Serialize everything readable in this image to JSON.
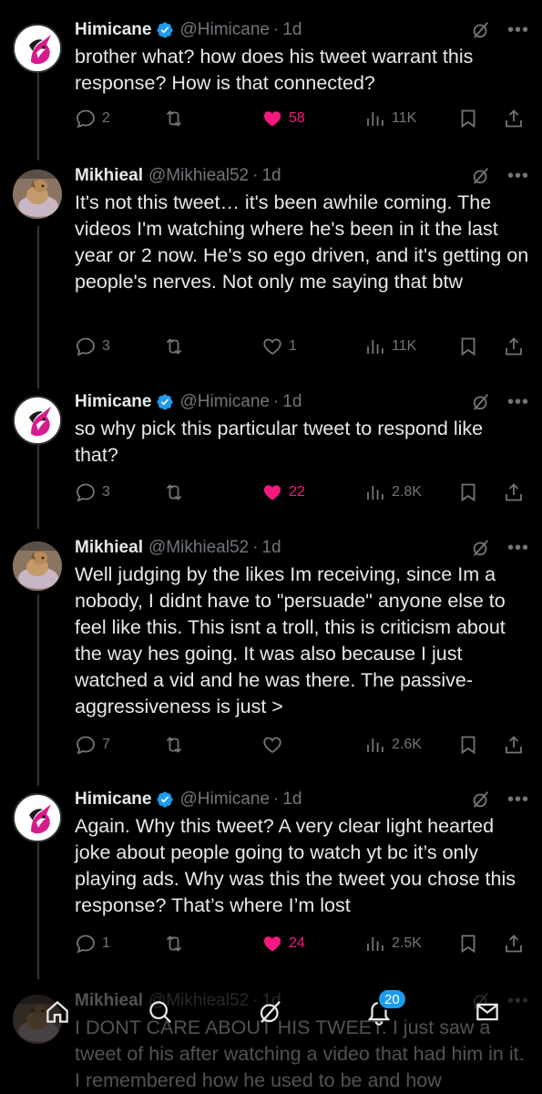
{
  "tweets": [
    {
      "name": "Himicane",
      "handle": "@Himicane",
      "sep": "·",
      "time": "1d",
      "verified": true,
      "avatar": "unicorn-logo",
      "text": "brother what? how does his tweet warrant this response? How is that connected?",
      "replies": "2",
      "likes": "58",
      "liked": true,
      "views": "11K"
    },
    {
      "name": "Mikhieal",
      "handle": "@Mikhieal52",
      "sep": "·",
      "time": "1d",
      "verified": false,
      "avatar": "dog-photo",
      "text": "It's not this tweet… it's been awhile coming. The videos I'm watching where he's been in it the last year or 2 now. He's so ego driven, and it's getting on people's nerves. Not only me saying that btw",
      "replies": "3",
      "likes": "1",
      "liked": false,
      "views": "11K"
    },
    {
      "name": "Himicane",
      "handle": "@Himicane",
      "sep": "·",
      "time": "1d",
      "verified": true,
      "avatar": "unicorn-logo",
      "text": "so why pick this particular tweet to respond like that?",
      "replies": "3",
      "likes": "22",
      "liked": true,
      "views": "2.8K"
    },
    {
      "name": "Mikhieal",
      "handle": "@Mikhieal52",
      "sep": "·",
      "time": "1d",
      "verified": false,
      "avatar": "dog-photo",
      "text": "Well judging by the likes Im receiving, since Im a nobody, I didnt have to \"persuade\" anyone else to feel like this. This isnt a troll, this is criticism about the way hes going. It was also because I just watched a vid and he was there. The passive-aggressiveness is just >",
      "replies": "7",
      "likes": "",
      "liked": false,
      "views": "2.6K"
    },
    {
      "name": "Himicane",
      "handle": "@Himicane",
      "sep": "·",
      "time": "1d",
      "verified": true,
      "avatar": "unicorn-logo",
      "text": "Again. Why this tweet? A very clear light hearted joke about people going to watch yt bc it’s only playing ads. Why was this the tweet you chose this response? That’s where I’m lost",
      "replies": "1",
      "likes": "24",
      "liked": true,
      "views": "2.5K"
    },
    {
      "name": "Mikhieal",
      "handle": "@Mikhieal52",
      "sep": "·",
      "time": "1d",
      "verified": false,
      "avatar": "dog-photo",
      "text": "I DONT CARE ABOUT HIS TWEET. I just saw a tweet of his after watching a video that had him in it. I remembered how he used to be and how"
    }
  ],
  "nav": {
    "notifications_badge": "20",
    "items": [
      "home-icon",
      "search-icon",
      "grok-icon",
      "notifications-icon",
      "messages-icon"
    ]
  },
  "colors": {
    "background": "#000000",
    "text": "#e7e9ea",
    "secondary": "#71767b",
    "like": "#f91880",
    "accent": "#1d9bf0"
  }
}
